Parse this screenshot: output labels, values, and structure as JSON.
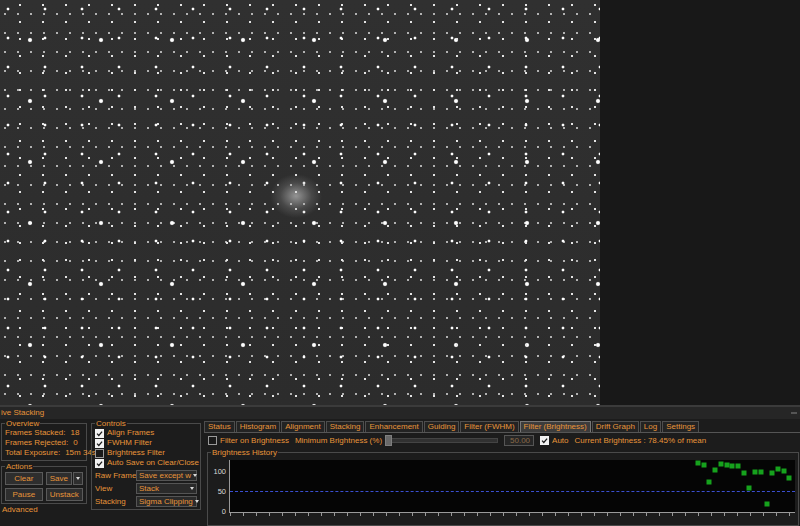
{
  "window": {
    "title": "ive Stacking"
  },
  "overview": {
    "title": "Overview",
    "rows": [
      {
        "label": "Frames Stacked:",
        "value": "18"
      },
      {
        "label": "Frames Rejected:",
        "value": "0"
      },
      {
        "label": "Total Exposure:",
        "value": "15m 34s"
      }
    ]
  },
  "actions": {
    "title": "Actions",
    "buttons": [
      "Clear",
      "Save",
      "Pause",
      "Unstack"
    ]
  },
  "advanced": {
    "title": "Advanced"
  },
  "controls": {
    "title": "Controls",
    "checkboxes": [
      {
        "label": "Align Frames",
        "checked": true
      },
      {
        "label": "FWHM Filter",
        "checked": true
      },
      {
        "label": "Brightness Filter",
        "checked": false
      },
      {
        "label": "Auto Save on Clear/Close",
        "checked": true
      }
    ],
    "selects": [
      {
        "label": "Raw Frames",
        "value": "Save except w"
      },
      {
        "label": "View",
        "value": "Stack"
      },
      {
        "label": "Stacking",
        "value": "Sigma Clipping"
      }
    ]
  },
  "tabs": [
    {
      "label": "Status",
      "selected": false
    },
    {
      "label": "Histogram",
      "selected": false
    },
    {
      "label": "Alignment",
      "selected": false
    },
    {
      "label": "Stacking",
      "selected": false
    },
    {
      "label": "Enhancement",
      "selected": false
    },
    {
      "label": "Guiding",
      "selected": false
    },
    {
      "label": "Filter (FWHM)",
      "selected": false
    },
    {
      "label": "Filter (Brightness)",
      "selected": true
    },
    {
      "label": "Drift Graph",
      "selected": false
    },
    {
      "label": "Log",
      "selected": false
    },
    {
      "label": "Settings",
      "selected": false
    }
  ],
  "brightness": {
    "filter": {
      "label": "Filter on Brightness",
      "checked": false
    },
    "minimum": {
      "label": "Minimum Brightness (%)",
      "level": 0,
      "disabled": true,
      "value": "50.00",
      "value_disabled": true
    },
    "auto": {
      "label": "Auto",
      "checked": true
    },
    "current": "Current Brightness : 78.45% of mean"
  },
  "chart": {
    "title": "Brightness History",
    "y_max": 130,
    "y_ticks": [
      "100",
      "50",
      "0"
    ],
    "threshold": 50,
    "series": [
      {
        "name": "brightness",
        "values": [
          123,
          118,
          75,
          105,
          120,
          118,
          116,
          114,
          98,
          61,
          100,
          100,
          20,
          98,
          107,
          102,
          86
        ]
      }
    ]
  }
}
